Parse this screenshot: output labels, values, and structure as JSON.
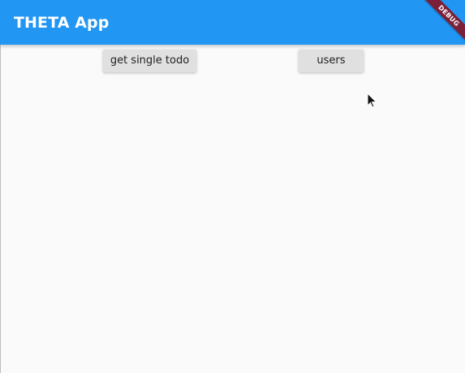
{
  "app": {
    "title": "THETA App",
    "debug_banner": "DEBUG"
  },
  "actions": {
    "get_single_todo_label": "get single todo",
    "users_label": "users"
  },
  "colors": {
    "appbar": "#2196f3",
    "debug_ribbon": "#7b2038",
    "background": "#fafafa",
    "button": "#e0e0e0"
  },
  "icons": {
    "cursor": "mouse-pointer-icon"
  }
}
